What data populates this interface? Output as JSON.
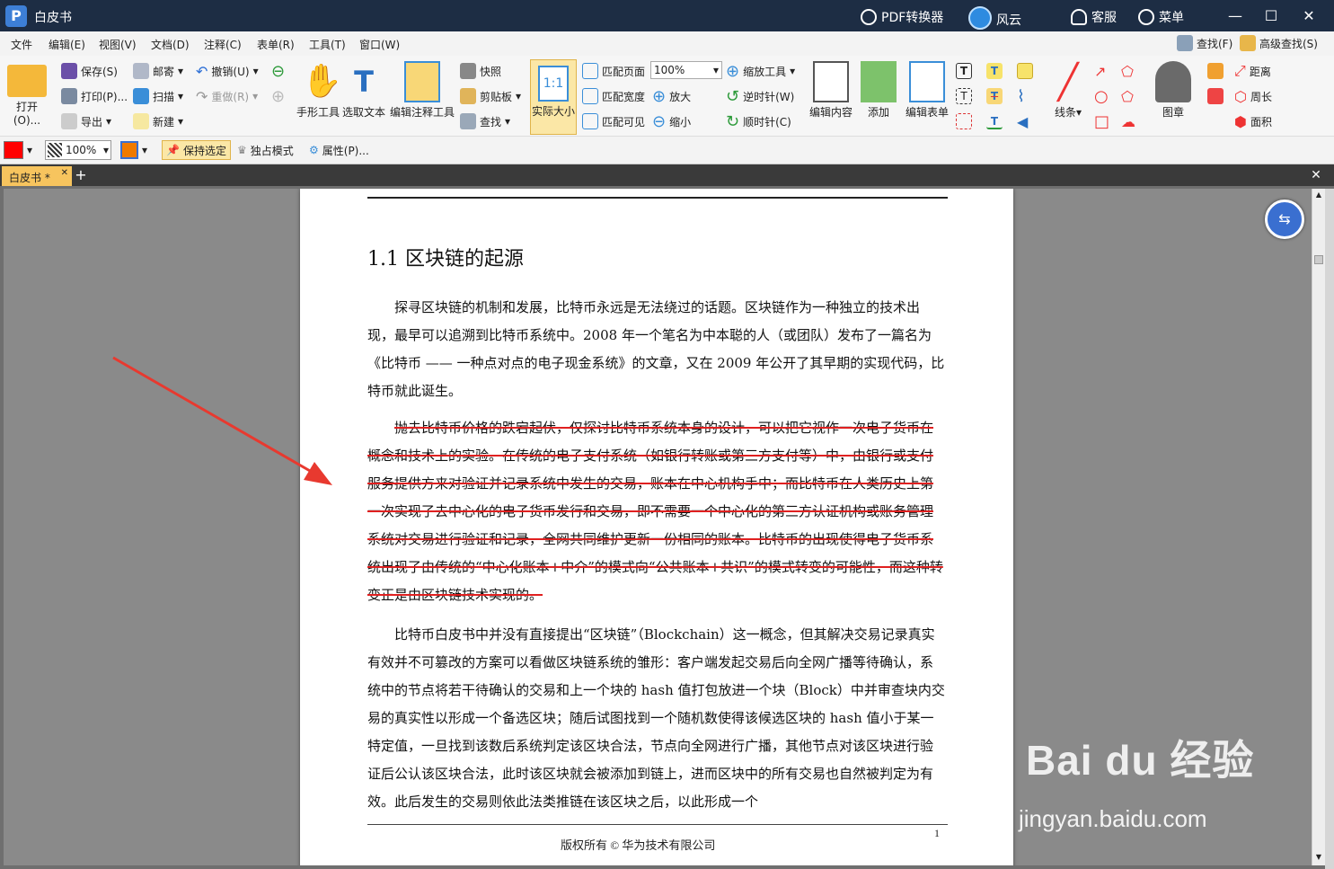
{
  "app": {
    "title": "白皮书"
  },
  "titlebar": {
    "pdf_converter": "PDF转换器",
    "fengyun": "风云",
    "service": "客服",
    "menu": "菜单"
  },
  "menubar": {
    "items": [
      "文件",
      "编辑(E)",
      "视图(V)",
      "文档(D)",
      "注释(C)",
      "表单(R)",
      "工具(T)",
      "窗口(W)"
    ],
    "find": "查找(F)",
    "advanced_find": "高级查找(S)"
  },
  "toolbar": {
    "open": "打开(O)...",
    "save": "保存(S)",
    "print": "打印(P)...",
    "export": "导出",
    "mail": "邮寄",
    "scan": "扫描",
    "new": "新建",
    "undo": "撤销(U)",
    "redo": "重做(R)",
    "hand_tool": "手形工具",
    "select_text": "选取文本",
    "edit_annotation": "编辑注释工具",
    "snapshot": "快照",
    "clipboard": "剪贴板",
    "find": "查找",
    "actual_size": "实际大小",
    "fit_page": "匹配页面",
    "fit_width": "匹配宽度",
    "fit_visible": "匹配可见",
    "zoom_value": "100%",
    "zoom_in": "放大",
    "zoom_out": "缩小",
    "zoom_tool": "缩放工具",
    "counterclockwise": "逆时针(W)",
    "clockwise": "顺时针(C)",
    "edit_content": "编辑内容",
    "add": "添加",
    "edit_form": "编辑表单",
    "lines": "线条",
    "stamp": "图章",
    "distance": "距离",
    "perimeter": "周长",
    "area": "面积"
  },
  "propbar": {
    "opacity": "100%",
    "keep_selected": "保持选定",
    "exclusive_mode": "独占模式",
    "properties": "属性(P)..."
  },
  "tab": {
    "label": "白皮书 *"
  },
  "document": {
    "heading": "1.1 区块链的起源",
    "para1": "探寻区块链的机制和发展，比特币永远是无法绕过的话题。区块链作为一种独立的技术出现，最早可以追溯到比特币系统中。2008 年一个笔名为中本聪的人（或团队）发布了一篇名为《比特币 —— 一种点对点的电子现金系统》的文章，又在 2009 年公开了其早期的实现代码，比特币就此诞生。",
    "para2": "抛去比特币价格的跌宕起伏，仅探讨比特币系统本身的设计，可以把它视作一次电子货币在概念和技术上的实验。在传统的电子支付系统（如银行转账或第三方支付等）中，由银行或支付服务提供方来对验证并记录系统中发生的交易，账本在中心机构手中；而比特币在人类历史上第一次实现了去中心化的电子货币发行和交易，即不需要一个中心化的第三方认证机构或账务管理系统对交易进行验证和记录，全网共同维护更新一份相同的账本。比特币的出现使得电子货币系统出现了由传统的“中心化账本+中介”的模式向“公共账本+共识”的模式转变的可能性，而这种转变正是由区块链技术实现的。",
    "para3": "比特币白皮书中并没有直接提出“区块链”（Blockchain）这一概念，但其解决交易记录真实有效并不可篡改的方案可以看做区块链系统的雏形：客户端发起交易后向全网广播等待确认，系统中的节点将若干待确认的交易和上一个块的 hash 值打包放进一个块（Block）中并审查块内交易的真实性以形成一个备选区块；随后试图找到一个随机数使得该候选区块的 hash 值小于某一特定值，一旦找到该数后系统判定该区块合法，节点向全网进行广播，其他节点对该区块进行验证后公认该区块合法，此时该区块就会被添加到链上，进而区块中的所有交易也自然被判定为有效。此后发生的交易则依此法类推链在该区块之后，以此形成一个",
    "footer": "版权所有 © 华为技术有限公司",
    "page_number": "1"
  },
  "watermark": {
    "brand": "Bai du 经验",
    "url": "jingyan.baidu.com"
  },
  "colors": {
    "titlebar": "#1d2d44",
    "tab": "#f7c45e",
    "arrow": "#e8392f",
    "strike": "#e02020"
  }
}
